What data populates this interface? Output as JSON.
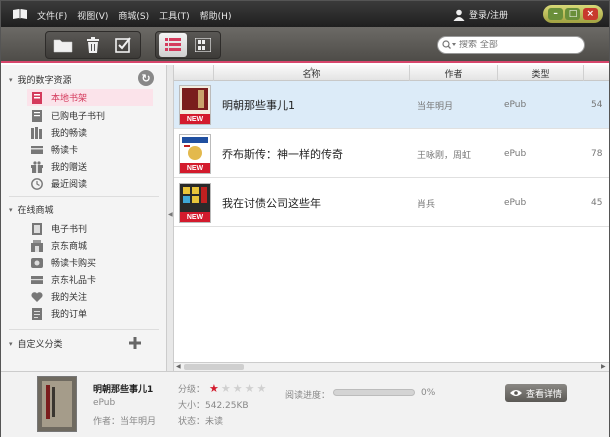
{
  "menu": [
    "文件(F)",
    "视图(V)",
    "商城(S)",
    "工具(T)",
    "帮助(H)"
  ],
  "login_label": "登录/注册",
  "search": {
    "placeholder": "搜索 全部"
  },
  "sidebar": {
    "my_resources": {
      "title": "我的数字资源",
      "items": [
        {
          "label": "本地书架",
          "icon": "bookshelf-icon",
          "active": true
        },
        {
          "label": "已购电子书刊",
          "icon": "purchased-icon"
        },
        {
          "label": "我的畅读",
          "icon": "books-icon"
        },
        {
          "label": "畅读卡",
          "icon": "card-icon"
        },
        {
          "label": "我的赠送",
          "icon": "gift-icon"
        },
        {
          "label": "最近阅读",
          "icon": "clock-icon"
        }
      ]
    },
    "online_store": {
      "title": "在线商城",
      "items": [
        {
          "label": "电子书刊",
          "icon": "ebook-icon"
        },
        {
          "label": "京东商城",
          "icon": "store-icon"
        },
        {
          "label": "畅读卡购买",
          "icon": "buy-card-icon"
        },
        {
          "label": "京东礼品卡",
          "icon": "giftcard-icon"
        },
        {
          "label": "我的关注",
          "icon": "heart-icon"
        },
        {
          "label": "我的订单",
          "icon": "order-icon"
        }
      ]
    },
    "custom": {
      "title": "自定义分类"
    }
  },
  "table": {
    "headers": {
      "name": "名称",
      "author": "作者",
      "type": "类型"
    },
    "rows": [
      {
        "title": "明朝那些事儿1",
        "author": "当年明月",
        "type": "ePub",
        "extra": "54",
        "badge": "NEW",
        "cover_color": "#7a1d1d"
      },
      {
        "title": "乔布斯传：神一样的传奇",
        "author": "王咏刚，周虹",
        "type": "ePub",
        "extra": "78",
        "badge": "NEW",
        "cover_color": "#1f4fa0"
      },
      {
        "title": "我在讨债公司这些年",
        "author": "肖兵",
        "type": "ePub",
        "extra": "45",
        "badge": "NEW",
        "cover_color": "#2a2a2a"
      }
    ]
  },
  "detail": {
    "title": "明朝那些事儿1",
    "format": "ePub",
    "author_line": "作者：当年明月",
    "rating_label": "分级：",
    "rating": 1,
    "rating_max": 5,
    "size_line": "大小：542.25KB",
    "status_line": "状态：未读",
    "progress_label": "阅读进度：",
    "progress_value": "0%",
    "view_button": "查看详情"
  },
  "colors": {
    "accent": "#d43a5c",
    "selected_row": "#dcebf8",
    "new_badge": "#d31b2d"
  }
}
